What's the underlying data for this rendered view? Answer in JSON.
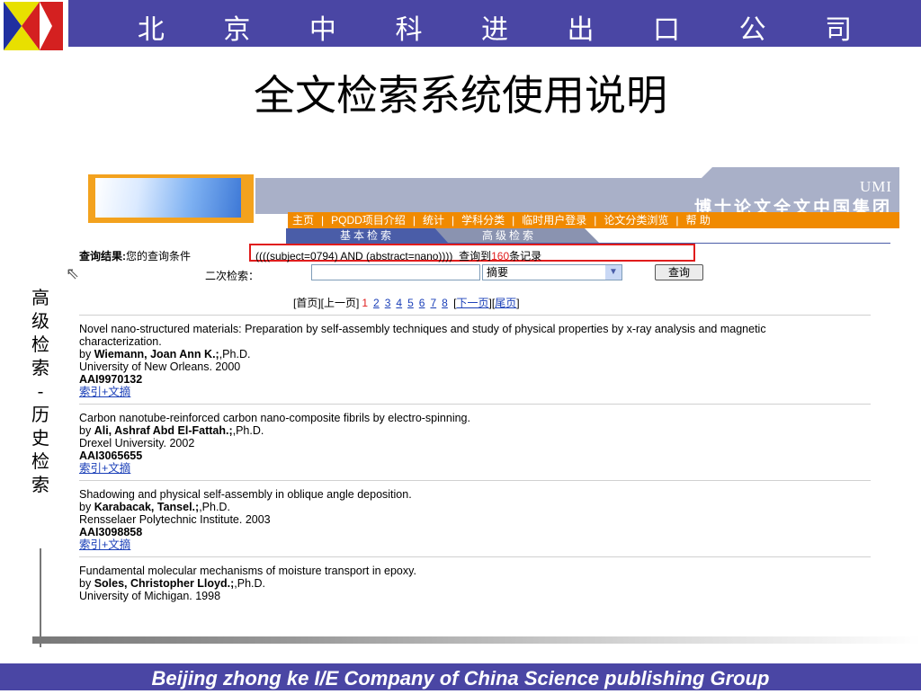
{
  "header": {
    "company": "北 京 中 科 进 出 口 公 司",
    "slide_title": "全文检索系统使用说明"
  },
  "side_label": [
    "高",
    "级",
    "检",
    "索",
    "-",
    "历",
    "史",
    "检",
    "索"
  ],
  "app": {
    "brand_umi": "UMI",
    "brand_cn": "博士论文全文中国集团",
    "nav": [
      "主页",
      "PQDD项目介绍",
      "统计",
      "学科分类",
      "临时用户登录",
      "论文分类浏览",
      "帮 助"
    ],
    "tabs": [
      "基本检索",
      "高级检索"
    ],
    "query": {
      "label": "查询结果:",
      "condition_label": "您的查询条件",
      "expression": "((((subject=0794) AND (abstract=nano))))",
      "found_prefix": "查询到",
      "count": "160",
      "found_suffix": "条记录"
    },
    "secondary_search": {
      "label": "二次检索：",
      "input_value": "",
      "field_select": "摘要",
      "button": "查询"
    },
    "pager": {
      "first": "[首页]",
      "prev": "[上一页]",
      "current": "1",
      "pages": [
        "2",
        "3",
        "4",
        "5",
        "6",
        "7",
        "8"
      ],
      "next": "下一页",
      "last": "尾页"
    },
    "results": [
      {
        "title": "Novel nano-structured materials: Preparation by self-assembly techniques and study of physical properties by x-ray analysis and magnetic characterization.",
        "by": "by",
        "author": "Wiemann, Joan Ann K.;",
        "degree": ",Ph.D.",
        "institution": "University of New Orleans. 2000",
        "id": "AAI9970132",
        "link": "索引+文摘"
      },
      {
        "title": "Carbon nanotube-reinforced carbon nano-composite fibrils by electro-spinning.",
        "by": "by",
        "author": "Ali, Ashraf Abd El-Fattah.;",
        "degree": ",Ph.D.",
        "institution": "Drexel University. 2002",
        "id": "AAI3065655",
        "link": "索引+文摘"
      },
      {
        "title": "Shadowing and physical self-assembly in oblique angle deposition.",
        "by": "by",
        "author": "Karabacak, Tansel.;",
        "degree": ",Ph.D.",
        "institution": "Rensselaer Polytechnic Institute. 2003",
        "id": "AAI3098858",
        "link": "索引+文摘"
      },
      {
        "title": "Fundamental molecular mechanisms of moisture transport in epoxy.",
        "by": "by",
        "author": "Soles, Christopher Lloyd.;",
        "degree": ",Ph.D.",
        "institution": "University of Michigan. 1998",
        "id": "",
        "link": ""
      }
    ]
  },
  "footer": {
    "text": "Beijing  zhong ke I/E Company of China Science publishing Group"
  },
  "colors": {
    "header_bar": "#4a46a4",
    "nav_orange": "#f08a00",
    "highlight_red": "#e01c1c",
    "link_blue": "#1a3fb8"
  }
}
